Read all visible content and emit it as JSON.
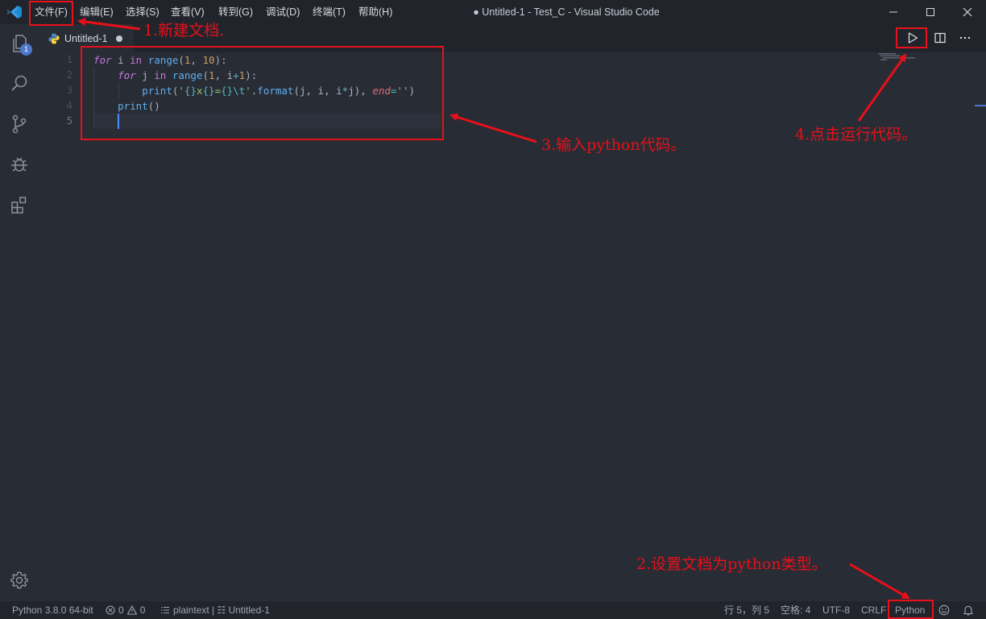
{
  "titlebar": {
    "menus": [
      "文件(F)",
      "编辑(E)",
      "选择(S)",
      "查看(V)",
      "转到(G)",
      "调试(D)",
      "终端(T)",
      "帮助(H)"
    ],
    "window_title": "● Untitled-1 - Test_C - Visual Studio Code"
  },
  "activitybar": {
    "explorer_badge": "1",
    "icons": [
      "files-icon",
      "search-icon",
      "source-control-icon",
      "debug-icon",
      "extensions-icon",
      "settings-gear-icon"
    ]
  },
  "tab": {
    "label": "Untitled-1",
    "modified": true,
    "language_icon": "python-icon"
  },
  "editor": {
    "line_numbers": [
      "1",
      "2",
      "3",
      "4",
      "5"
    ],
    "lines": [
      "for i in range(1, 10):",
      "    for j in range(1, i+1):",
      "        print('{}x{}={}\\t'.format(j, i, i*j), end='')",
      "    print()",
      "    "
    ],
    "cursor_line": 5
  },
  "statusbar": {
    "interpreter": "Python 3.8.0 64-bit",
    "errors": "0",
    "warnings": "0",
    "outline": "plaintext | ☷ Untitled-1",
    "position": "行 5，列 5",
    "indent": "空格: 4",
    "encoding": "UTF-8",
    "eol": "CRLF",
    "language": "Python"
  },
  "annotations": {
    "step1": "1.新建文档.",
    "step2": "2.设置文档为python类型。",
    "step3": "3.输入python代码。",
    "step4": "4.点击运行代码。"
  },
  "colors": {
    "annotation_red": "#e8101a",
    "accent_blue": "#4d78cc",
    "editor_bg": "#282c34",
    "chrome_bg": "#21252b"
  }
}
